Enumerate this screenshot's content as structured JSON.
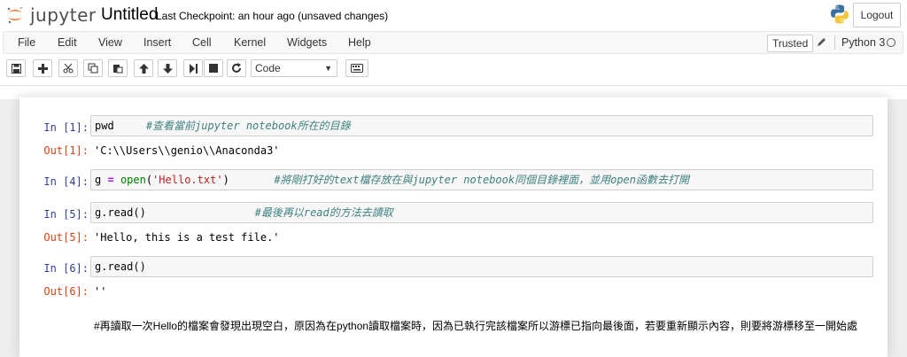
{
  "header": {
    "logo_text": "jupyter",
    "notebook_title": "Untitled",
    "checkpoint": "Last Checkpoint: an hour ago (unsaved changes)",
    "logout_label": "Logout"
  },
  "menubar": {
    "items": [
      "File",
      "Edit",
      "View",
      "Insert",
      "Cell",
      "Kernel",
      "Widgets",
      "Help"
    ],
    "trusted_label": "Trusted",
    "kernel_name": "Python 3"
  },
  "toolbar": {
    "cell_type": "Code",
    "icons": [
      "save-icon",
      "plus-icon",
      "cut-icon",
      "copy-icon",
      "paste-icon",
      "arrow-up-icon",
      "arrow-down-icon",
      "step-forward-icon",
      "stop-icon",
      "restart-icon",
      "keyboard-icon"
    ]
  },
  "cells": [
    {
      "in_prompt": "In [1]:",
      "code": "pwd",
      "comment": "#查看當前jupyter notebook所在的目錄",
      "out_prompt": "Out[1]:",
      "output": "'C:\\\\Users\\\\genio\\\\Anaconda3'"
    },
    {
      "in_prompt": "In [4]:",
      "code_var": "g",
      "code_eq": "=",
      "code_func": "open",
      "code_open": "(",
      "code_str": "'Hello.txt'",
      "code_close": ")",
      "comment": "#將剛打好的text檔存放在與jupyter notebook同個目錄裡面，並用open函數去打開"
    },
    {
      "in_prompt": "In [5]:",
      "code": "g.read()",
      "comment": "#最後再以read的方法去讀取",
      "out_prompt": "Out[5]:",
      "output": "'Hello, this is a test file.'"
    },
    {
      "in_prompt": "In [6]:",
      "code": "g.read()",
      "out_prompt": "Out[6]:",
      "output": "''"
    }
  ],
  "markdown": "#再讀取一次Hello的檔案會發現出現空白，原因為在python讀取檔案時，因為已執行完該檔案所以游標已指向最後面，若要重新顯示內容，則要將游標移至一開始處"
}
